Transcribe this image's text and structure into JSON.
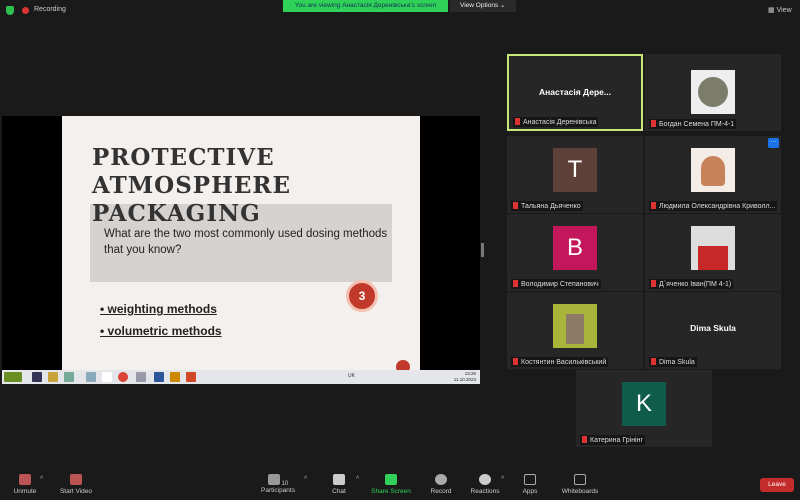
{
  "topbar": {
    "recording": "Recording",
    "banner": "You are viewing Анастасія Деренівська's screen",
    "view_options": "View Options",
    "view": "View"
  },
  "slide": {
    "title_line1": "PROTECTIVE ATMOSPHERE",
    "title_line2": "PACKAGING",
    "question": "What are the two most commonly used dosing methods that you know?",
    "badge": "3",
    "bullets": [
      "weighting methods",
      "volumetric methods"
    ]
  },
  "taskbar": {
    "clock_time": "13:26",
    "clock_date": "11.10.2023",
    "lang": "UK"
  },
  "participants": [
    {
      "name": "Анастасія Деренівська",
      "display": "Анастасія Дере...",
      "avatar": "",
      "color": ""
    },
    {
      "name": "Богдан Семена ПМ-4-1",
      "avatar": "photo",
      "color": "#e9e9e9"
    },
    {
      "name": "Тальяна Дьяченко",
      "avatar": "T",
      "color": "#5d4037"
    },
    {
      "name": "Людмила Олександрівна Криволл...",
      "avatar": "photo",
      "color": "#f1d3c3"
    },
    {
      "name": "Володимир Степанович",
      "avatar": "B",
      "color": "#c2185b"
    },
    {
      "name": "Д`яченко Іван(ПМ 4-1)",
      "avatar": "photo",
      "color": "#c62828"
    },
    {
      "name": "Костянтин Васильківський",
      "avatar": "photo",
      "color": "#8a9a3a"
    },
    {
      "name": "Dima Skula",
      "display": "Dima Skula",
      "avatar": "",
      "color": ""
    },
    {
      "name": "Катерина Грінінг",
      "avatar": "K",
      "color": "#0f5c4a"
    }
  ],
  "toolbar": {
    "unmute": "Unmute",
    "start_video": "Start Video",
    "participants": "Participants",
    "participants_count": "10",
    "chat": "Chat",
    "share_screen": "Share Screen",
    "record": "Record",
    "reactions": "Reactions",
    "apps": "Apps",
    "whiteboards": "Whiteboards",
    "leave": "Leave"
  }
}
